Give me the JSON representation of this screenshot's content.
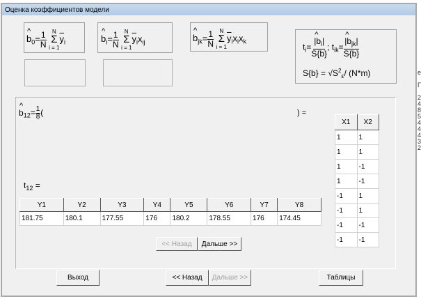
{
  "window": {
    "title": "Оценка коэффициентов модели"
  },
  "formulas": {
    "b0": {
      "lhs": "b",
      "sub": "0",
      "frac_n": "1",
      "frac_d": "N",
      "sum_top": "N",
      "sum_bot": "i = 1",
      "term": "y",
      "term_sub": "i"
    },
    "bi": {
      "lhs": "b",
      "sub": "i",
      "frac_n": "1",
      "frac_d": "N",
      "sum_top": "N",
      "sum_bot": "i = 1",
      "term": "y",
      "term_sub": "i",
      "x": "x",
      "x_sub": "ij"
    },
    "bik": {
      "lhs": "b",
      "sub": "jk",
      "frac_n": "1",
      "frac_d": "N",
      "sum_top": "N",
      "sum_bot": "i = 1",
      "term": "y",
      "term_sub": "i",
      "x1": "x",
      "x1_sub": "i",
      "x2": "x",
      "x2_sub": "k"
    },
    "t": {
      "ti": "t",
      "ti_sub": "i",
      "ti_num": "|b",
      "ti_num_sub": "i",
      "ti_den": "S{b}",
      "sep": ";",
      "tik": "t",
      "tik_sub": "ik",
      "tik_num": "|b",
      "tik_num_sub": "jk",
      "tik_den": "S{b}",
      "sb": "S{b} = √S",
      "sb_sup": "2",
      "sb_sub": "ε",
      "sb_rest": "/ (N*m)"
    }
  },
  "calc": {
    "b12_lhs": "b",
    "b12_sub": "12",
    "frac_n": "1",
    "frac_d": "8",
    "open": "(",
    "close": ") =",
    "t12": "t",
    "t12_sub": "12",
    "t12_eq": " ="
  },
  "x_table": {
    "headers": [
      "X1",
      "X2"
    ],
    "rows": [
      [
        "1",
        "1"
      ],
      [
        "1",
        "1"
      ],
      [
        "1",
        "-1"
      ],
      [
        "1",
        "-1"
      ],
      [
        "-1",
        "1"
      ],
      [
        "-1",
        "1"
      ],
      [
        "-1",
        "-1"
      ],
      [
        "-1",
        "-1"
      ]
    ]
  },
  "y_table": {
    "headers": [
      "Y1",
      "Y2",
      "Y3",
      "Y4",
      "Y5",
      "Y6",
      "Y7",
      "Y8"
    ],
    "values": [
      "181.75",
      "180.1",
      "177.55",
      "176",
      "180.2",
      "178.55",
      "176",
      "174.45"
    ]
  },
  "inner_nav": {
    "back": "<< Назад",
    "next": "Дальше >>"
  },
  "footer": {
    "exit": "Выход",
    "back": "<< Назад",
    "next": "Дальше >>",
    "tables": "Таблицы"
  }
}
